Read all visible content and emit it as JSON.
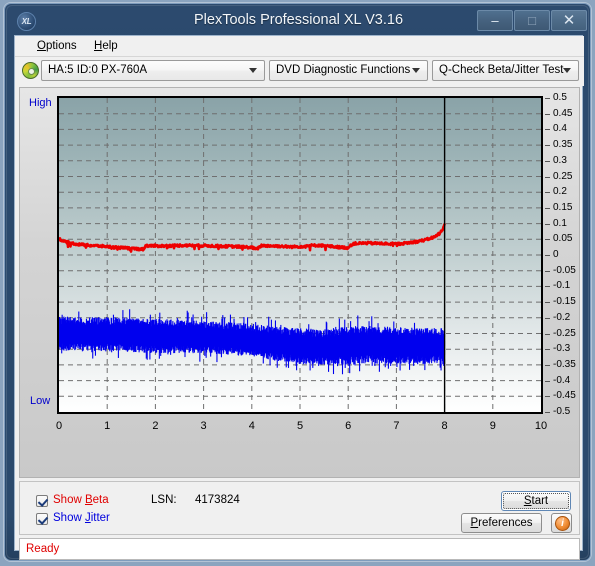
{
  "window": {
    "title": "PlexTools Professional XL V3.16",
    "logo_text": "XL",
    "minimize_glyph": "–",
    "maximize_glyph": "□",
    "close_glyph": "✕"
  },
  "menu": {
    "options": "Options",
    "options_mnemonic": "O",
    "help": "Help",
    "help_mnemonic": "H"
  },
  "toolbar": {
    "drive": "HA:5 ID:0  PX-760A",
    "function": "DVD Diagnostic Functions",
    "test": "Q-Check Beta/Jitter Test"
  },
  "chart_axis": {
    "high_label": "High",
    "low_label": "Low"
  },
  "controls": {
    "show_beta": "Show Beta",
    "show_beta_mnemonic": "B",
    "show_jitter": "Show Jitter",
    "show_jitter_mnemonic": "J",
    "lsn_label": "LSN:",
    "lsn_value": "4173824",
    "start": "Start",
    "start_mnemonic": "S",
    "preferences": "Preferences",
    "preferences_mnemonic": "P",
    "info_glyph": "i"
  },
  "status": {
    "text": "Ready"
  },
  "colors": {
    "beta": "#ee0000",
    "jitter": "#0000ee",
    "title_bar": "#2b4a6d",
    "status_text": "#e00000",
    "axis_label": "#0000cc"
  },
  "chart_data": {
    "type": "line",
    "title": "Q-Check Beta/Jitter Test",
    "xlabel": "",
    "ylabel": "",
    "xlim": [
      0,
      10
    ],
    "ylim": [
      -0.5,
      0.5
    ],
    "grid": true,
    "legend_position": "bottom-left",
    "data_end_x": 8,
    "xticks": [
      0,
      1,
      2,
      3,
      4,
      5,
      6,
      7,
      8,
      9,
      10
    ],
    "yticks": [
      0.5,
      0.45,
      0.4,
      0.35,
      0.3,
      0.25,
      0.2,
      0.15,
      0.1,
      0.05,
      0,
      -0.05,
      -0.1,
      -0.15,
      -0.2,
      -0.25,
      -0.3,
      -0.35,
      -0.4,
      -0.45,
      -0.5
    ],
    "series": [
      {
        "name": "Beta",
        "color": "#ee0000",
        "x": [
          0.0,
          0.1,
          0.25,
          0.4,
          0.6,
          0.8,
          1.0,
          1.2,
          1.4,
          1.6,
          1.75,
          1.8,
          2.0,
          2.2,
          2.4,
          2.6,
          2.8,
          3.0,
          3.2,
          3.4,
          3.6,
          3.8,
          4.0,
          4.1,
          4.2,
          4.4,
          4.6,
          4.8,
          5.0,
          5.2,
          5.4,
          5.6,
          5.8,
          6.0,
          6.1,
          6.2,
          6.4,
          6.6,
          6.8,
          7.0,
          7.2,
          7.4,
          7.6,
          7.8,
          7.9,
          7.97,
          8.0
        ],
        "y": [
          0.052,
          0.043,
          0.038,
          0.034,
          0.031,
          0.029,
          0.027,
          0.024,
          0.022,
          0.02,
          0.018,
          0.03,
          0.029,
          0.029,
          0.03,
          0.031,
          0.03,
          0.03,
          0.029,
          0.028,
          0.027,
          0.026,
          0.024,
          0.018,
          0.03,
          0.029,
          0.028,
          0.026,
          0.027,
          0.03,
          0.031,
          0.028,
          0.025,
          0.023,
          0.036,
          0.037,
          0.038,
          0.037,
          0.036,
          0.035,
          0.038,
          0.042,
          0.048,
          0.058,
          0.07,
          0.085,
          0.095
        ],
        "noise_amplitude": 0.008
      },
      {
        "name": "Jitter",
        "color": "#0000ee",
        "x": [
          0.0,
          0.5,
          1.0,
          1.5,
          2.0,
          2.5,
          3.0,
          3.5,
          4.0,
          4.5,
          5.0,
          5.5,
          6.0,
          6.5,
          7.0,
          7.5,
          8.0
        ],
        "center": [
          -0.25,
          -0.252,
          -0.252,
          -0.255,
          -0.258,
          -0.258,
          -0.262,
          -0.265,
          -0.272,
          -0.282,
          -0.29,
          -0.295,
          -0.288,
          -0.285,
          -0.288,
          -0.29,
          -0.288
        ],
        "band_half_width": [
          0.055,
          0.055,
          0.055,
          0.055,
          0.055,
          0.055,
          0.052,
          0.052,
          0.052,
          0.055,
          0.058,
          0.058,
          0.062,
          0.06,
          0.058,
          0.058,
          0.055
        ],
        "noise_amplitude": 0.06
      }
    ]
  }
}
